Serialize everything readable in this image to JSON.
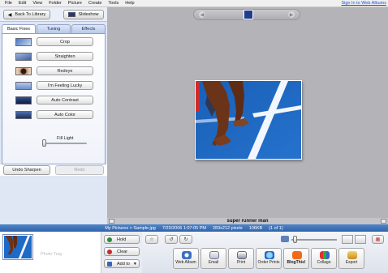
{
  "menu": {
    "items": [
      "File",
      "Edit",
      "View",
      "Folder",
      "Picture",
      "Create",
      "Tools",
      "Help"
    ],
    "sign_in": "Sign In to Web Albums"
  },
  "toolbar": {
    "back_label": "Back To Library",
    "slideshow_label": "Slideshow"
  },
  "tabs": [
    {
      "label": "Basic Fixes",
      "active": true
    },
    {
      "label": "Tuning",
      "active": false
    },
    {
      "label": "Effects",
      "active": false
    }
  ],
  "fixes": [
    {
      "label": "Crop",
      "icon": "crop-thumb"
    },
    {
      "label": "Straighten",
      "icon": "straighten-thumb"
    },
    {
      "label": "Redeye",
      "icon": "redeye-thumb"
    },
    {
      "label": "I'm Feeling Lucky",
      "icon": "lucky-thumb"
    },
    {
      "label": "Auto Contrast",
      "icon": "contrast-thumb"
    },
    {
      "label": "Auto Color",
      "icon": "color-thumb"
    }
  ],
  "fill_light": {
    "label": "Fill Light",
    "value": 0
  },
  "undo_label": "Undo Sharpen",
  "redo_label": "Redo",
  "caption": "super runner man",
  "status": {
    "path": "My Pictures > Sample.jpg",
    "date": "7/23/2006 1:07:05 PM",
    "dims": "283x212 pixels",
    "size": "106KB",
    "count": "(1 of 1)"
  },
  "tray": {
    "label": "Photo Tray"
  },
  "tray_buttons": {
    "hold": "Hold",
    "clear": "Clear",
    "add_to": "Add to"
  },
  "share_buttons": [
    "Web Album",
    "Email",
    "Print",
    "Order Prints",
    "BlogThis!",
    "Collage",
    "Export"
  ],
  "colors": {
    "status_bar": "#3a6fb8",
    "canvas": "#b4b3b7",
    "panel": "#dfe6f4",
    "link": "#1a4fd6"
  }
}
